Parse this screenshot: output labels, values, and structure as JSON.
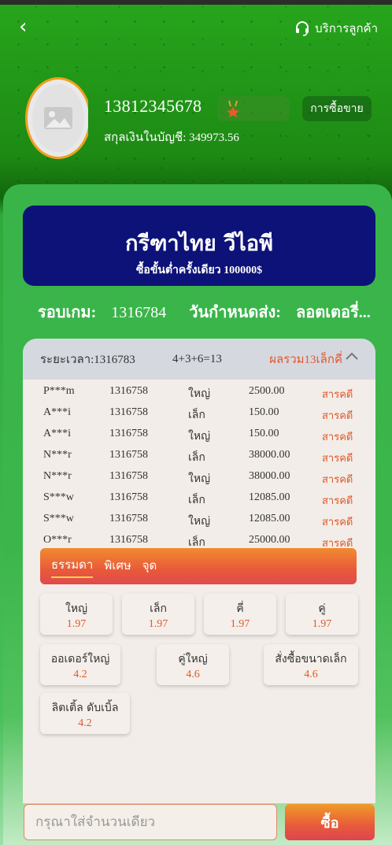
{
  "header": {
    "back_icon": "chevron-left-icon",
    "service_label": "บริการลูกค้า"
  },
  "profile": {
    "phone": "13812345678",
    "balance_text": "สกุลเงินในบัญชี: 349973.56",
    "trade_label": "การซื้อขาย"
  },
  "banner": {
    "title": "กรีฑาไทย วีไอพี",
    "subtitle": "ซื้อขั้นต่ำครั้งเดียว 100000$"
  },
  "round": {
    "label": "รอบเกม:",
    "value": "1316784",
    "deadline_label": "วันกำหนดส่ง:",
    "deadline_value": "ลอตเตอรี่..."
  },
  "history_header": {
    "period": "ระยะเวลา:1316783",
    "dice": "4+3+6=13",
    "sum": "ผลรวม13เล็กคี่"
  },
  "history": [
    {
      "user": "P***m",
      "period": "1316758",
      "type": "ใหญ่",
      "amount": "2500.00",
      "result": "สารคดี"
    },
    {
      "user": "A***i",
      "period": "1316758",
      "type": "เล็ก",
      "amount": "150.00",
      "result": "สารคดี"
    },
    {
      "user": "A***i",
      "period": "1316758",
      "type": "ใหญ่",
      "amount": "150.00",
      "result": "สารคดี"
    },
    {
      "user": "N***r",
      "period": "1316758",
      "type": "เล็ก",
      "amount": "38000.00",
      "result": "สารคดี"
    },
    {
      "user": "N***r",
      "period": "1316758",
      "type": "ใหญ่",
      "amount": "38000.00",
      "result": "สารคดี"
    },
    {
      "user": "S***w",
      "period": "1316758",
      "type": "เล็ก",
      "amount": "12085.00",
      "result": "สารคดี"
    },
    {
      "user": "S***w",
      "period": "1316758",
      "type": "ใหญ่",
      "amount": "12085.00",
      "result": "สารคดี"
    },
    {
      "user": "O***r",
      "period": "1316758",
      "type": "เล็ก",
      "amount": "25000.00",
      "result": "สารคดี"
    }
  ],
  "tabs": [
    "ธรรมดา",
    "พิเศษ",
    "จุด"
  ],
  "odds": [
    {
      "label": "ใหญ่",
      "value": "1.97"
    },
    {
      "label": "เล็ก",
      "value": "1.97"
    },
    {
      "label": "คี่",
      "value": "1.97"
    },
    {
      "label": "คู่",
      "value": "1.97"
    },
    {
      "label": "ออเดอร์ใหญ่",
      "value": "4.2"
    },
    {
      "label": "คู่ใหญ่",
      "value": "4.6"
    },
    {
      "label": "สั่งซื้อขนาดเล็ก",
      "value": "4.6"
    },
    {
      "label": "ลิตเติ้ล ดับเบิ้ล",
      "value": "4.2"
    }
  ],
  "footer": {
    "input_placeholder": "กรุณาใส่จำนวนเดียว",
    "buy_label": "ซื้อ"
  },
  "colors": {
    "banner_bg": "#0d1278",
    "accent_orange": "#e0582a",
    "panel_green": "#3cb64b"
  }
}
